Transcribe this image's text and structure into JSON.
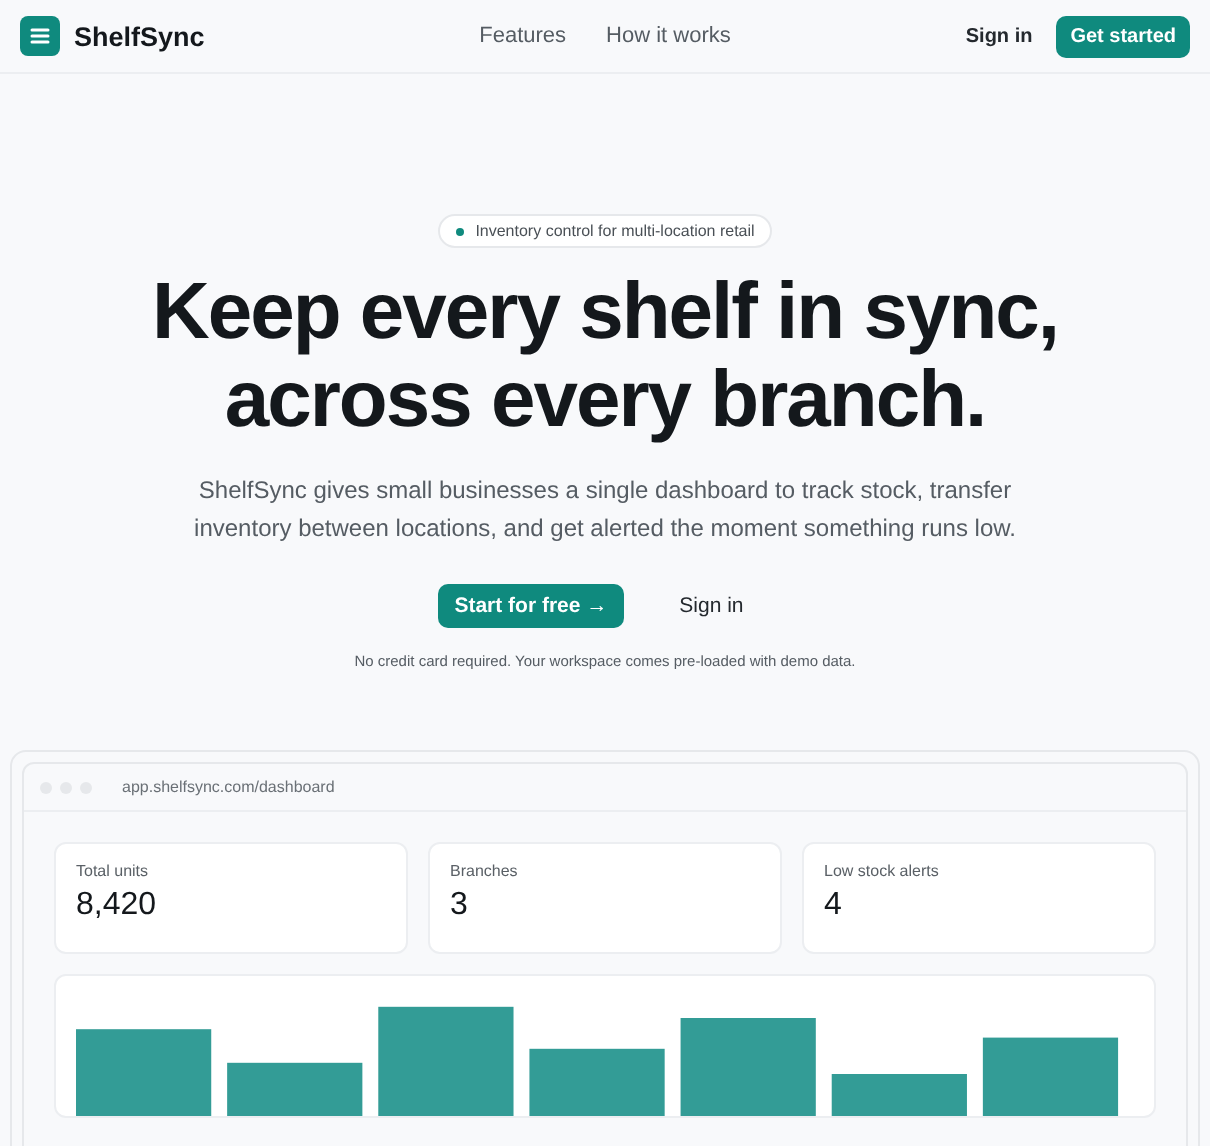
{
  "nav": {
    "brand": "ShelfSync",
    "links": [
      "Features",
      "How it works"
    ],
    "sign_in": "Sign in",
    "cta": "Get started"
  },
  "hero": {
    "badge": "Inventory control for multi-location retail",
    "title_lines": [
      "Keep every shelf in sync,",
      "across every branch."
    ],
    "subtitle": "ShelfSync gives small businesses a single dashboard to track stock, transfer inventory between locations, and get alerted the moment something runs low.",
    "primary": "Start for free",
    "primary_icon": "→",
    "secondary": "Sign in",
    "note": "No credit card required. Your workspace comes pre-loaded with demo data."
  },
  "preview": {
    "url": "app.shelfsync.com/dashboard",
    "stats": [
      {
        "label": "Total units",
        "value": "8,420"
      },
      {
        "label": "Branches",
        "value": "3"
      },
      {
        "label": "Low stock alerts",
        "value": "4"
      }
    ]
  }
}
